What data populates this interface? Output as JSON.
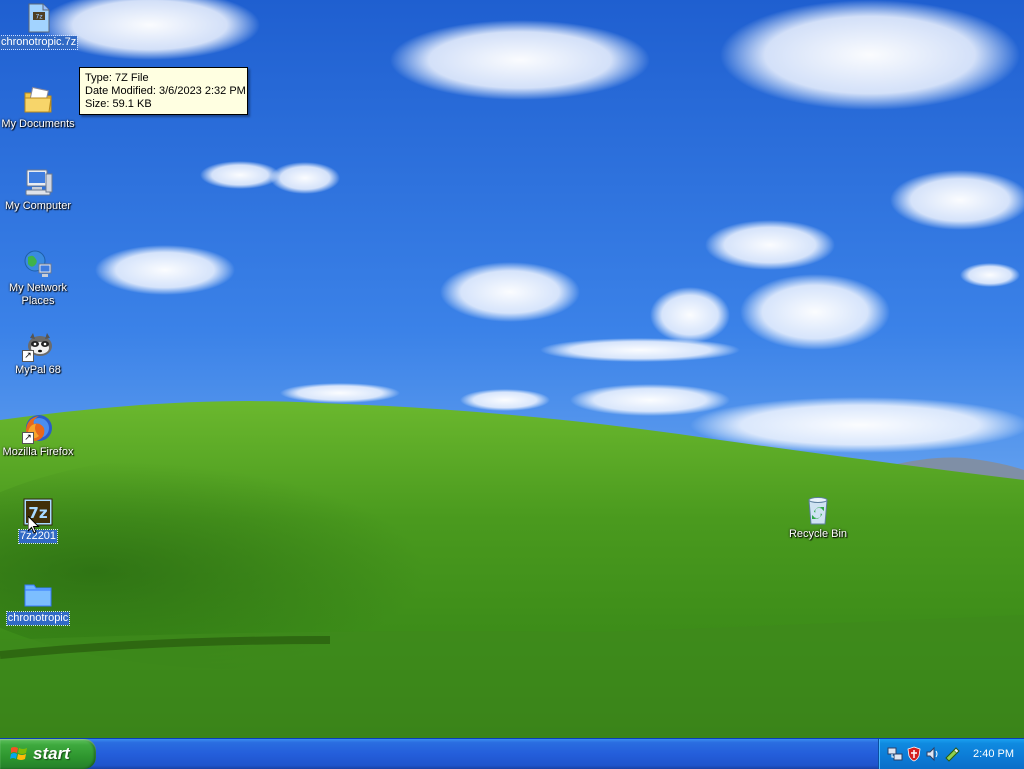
{
  "desktop": {
    "icons": [
      {
        "label": "chronotropic.7z",
        "icon": "archive-file-icon",
        "selected": true
      },
      {
        "label": "My Documents",
        "icon": "folder-documents-icon"
      },
      {
        "label": "My Computer",
        "icon": "computer-icon"
      },
      {
        "label": "My Network Places",
        "icon": "network-icon"
      },
      {
        "label": "MyPal 68",
        "icon": "mypal-icon",
        "shortcut": true
      },
      {
        "label": "Mozilla Firefox",
        "icon": "firefox-icon",
        "shortcut": true
      },
      {
        "label": "7z2201",
        "icon": "7zip-installer-icon",
        "selected": true
      },
      {
        "label": "chronotropic",
        "icon": "folder-icon",
        "selected": true
      },
      {
        "label": "Recycle Bin",
        "icon": "recycle-bin-icon"
      }
    ]
  },
  "tooltip": {
    "type_line": "Type: 7Z File",
    "modified_line": "Date Modified: 3/6/2023 2:32 PM",
    "size_line": "Size: 59.1 KB"
  },
  "taskbar": {
    "start_label": "start",
    "clock": "2:40 PM",
    "tray_icons": [
      "network-icon",
      "security-shield-icon",
      "speaker-icon",
      "update-icon"
    ]
  },
  "colors": {
    "sky": "#2e6fd6",
    "hill": "#4e9a2a",
    "taskbar": "#245edb",
    "start_button": "#3ea93e",
    "selection": "#316ac5",
    "tooltip_bg": "#ffffe1"
  }
}
